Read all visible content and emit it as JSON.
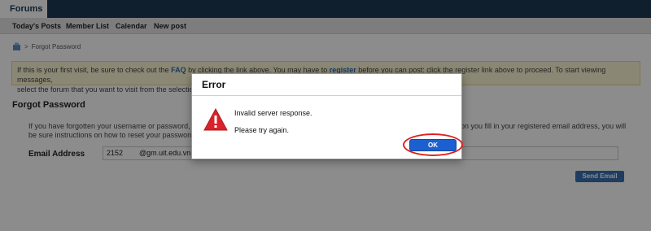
{
  "header": {
    "forums_tab": "Forums"
  },
  "nav": {
    "items": [
      "Today's Posts",
      "Member List",
      "Calendar",
      "New post"
    ]
  },
  "breadcrumb": {
    "separator": ">",
    "current": "Forgot Password"
  },
  "notice": {
    "part1": "If this is your first visit, be sure to check out the ",
    "faq_link": "FAQ",
    "part2": " by clicking the link above. You may have to ",
    "register_link": "register",
    "part3": " before you can post: click the register link above to proceed. To start viewing messages,",
    "line2": "select the forum that you want to visit from the selectio"
  },
  "form": {
    "title": "Forgot Password",
    "instructions_left": "If you have forgotten your username or password, y",
    "instructions_left2": "be sure instructions on how to reset your password.",
    "instructions_right": "on you fill in your registered email address, you will",
    "email_label": "Email Address",
    "email_prefix": "2152",
    "email_suffix": "@gm.uit.edu.vn",
    "send_button": "Send Email"
  },
  "dialog": {
    "title": "Error",
    "message": "Invalid server response.",
    "sub_message": "Please try again.",
    "ok_button": "OK"
  },
  "colors": {
    "topbar": "#1c3a52",
    "notice_bg": "#fbf6d4",
    "ok_button": "#1c5fd0",
    "highlight_circle": "#e02020"
  }
}
